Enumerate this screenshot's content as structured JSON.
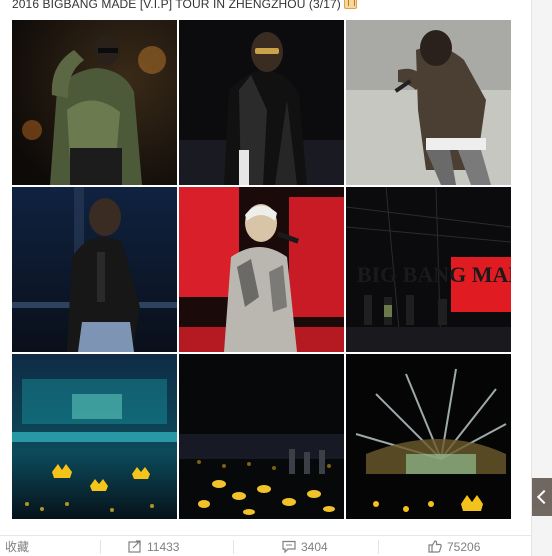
{
  "post": {
    "title": "2016 BIGBANG MADE [V.I.P] TOUR IN ZHENGZHOU (3/17)"
  },
  "photos": [
    {
      "label": "concert-photo-1"
    },
    {
      "label": "concert-photo-2"
    },
    {
      "label": "concert-photo-3"
    },
    {
      "label": "concert-photo-4"
    },
    {
      "label": "concert-photo-5"
    },
    {
      "label": "concert-photo-6"
    },
    {
      "label": "concert-photo-7"
    },
    {
      "label": "concert-photo-8"
    },
    {
      "label": "concert-photo-9"
    }
  ],
  "stage_screen_text": "BIG BANG MADE [V.I.P]",
  "actions": {
    "favorite_label": "收藏",
    "share_count": "11433",
    "comment_count": "3404",
    "like_count": "75206"
  },
  "icons": {
    "share": "share-icon",
    "comment": "comment-icon",
    "like": "thumbs-up-icon",
    "badge": "badge-icon",
    "scroll": "scroll-up-icon"
  },
  "colors": {
    "text": "#333333",
    "muted": "#808080",
    "stage_red": "#d81f2a",
    "lightstick_yellow": "#f6c319"
  }
}
